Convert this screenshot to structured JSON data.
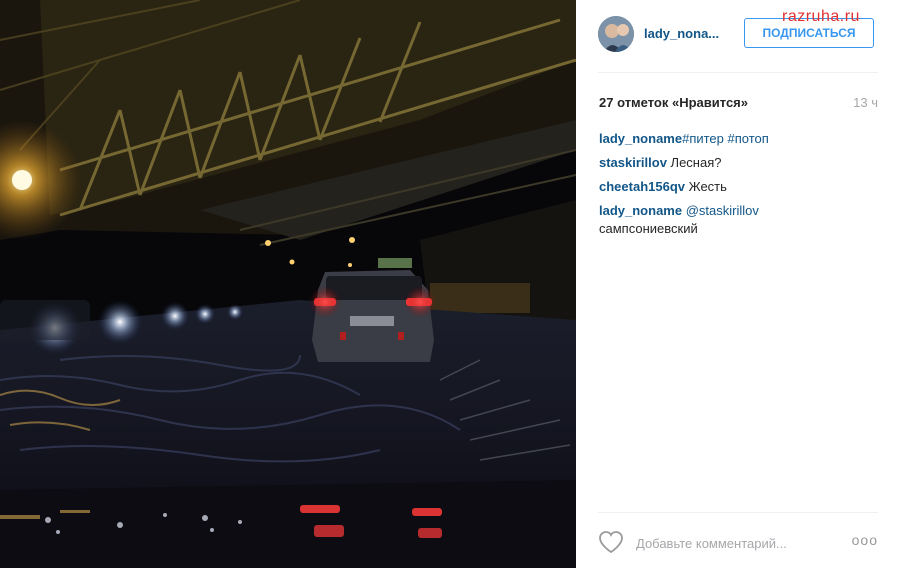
{
  "watermark": "razruha.ru",
  "post": {
    "username": "lady_nona...",
    "follow_label": "ПОДПИСАТЬСЯ",
    "likes": "27 отметок «Нравится»",
    "time": "13 ч",
    "comments": [
      {
        "user": "lady_noname",
        "text": "",
        "tags": "#питер #потоп"
      },
      {
        "user": "staskirillov",
        "text": " Лесная?",
        "tags": ""
      },
      {
        "user": "cheetah156qv",
        "text": " Жесть",
        "tags": ""
      },
      {
        "user": "lady_noname",
        "text": " сампсониевский",
        "tags": " @staskirillov"
      }
    ],
    "comment_placeholder": "Добавьте комментарий...",
    "more_label": "ooo"
  },
  "icons": {
    "avatar": "avatar-image",
    "heart": "heart-icon",
    "more": "more-options-icon"
  }
}
